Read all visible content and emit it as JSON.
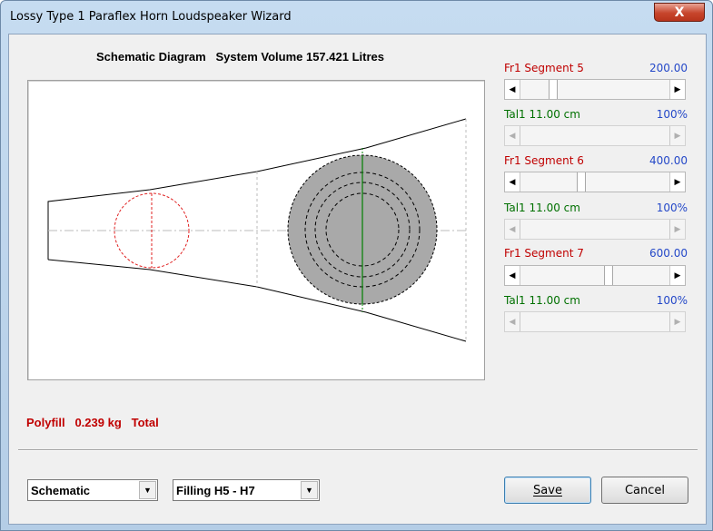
{
  "window": {
    "title": "Lossy Type 1 Paraflex Horn Loudspeaker Wizard",
    "close_glyph": "X"
  },
  "header": {
    "label": "Schematic Diagram",
    "volume": "System Volume 157.421 Litres"
  },
  "segments": [
    {
      "fr_label": "Fr1  Segment 5",
      "fr_value": "200.00",
      "fr_slider_fraction": 0.2,
      "tal_label": "Tal1  11.00 cm",
      "tal_value": "100%"
    },
    {
      "fr_label": "Fr1  Segment 6",
      "fr_value": "400.00",
      "fr_slider_fraction": 0.4,
      "tal_label": "Tal1  11.00 cm",
      "tal_value": "100%"
    },
    {
      "fr_label": "Fr1  Segment 7",
      "fr_value": "600.00",
      "fr_slider_fraction": 0.6,
      "tal_label": "Tal1  11.00 cm",
      "tal_value": "100%"
    }
  ],
  "polyfill": {
    "text": "Polyfill   0.239 kg   Total"
  },
  "view_combo": {
    "value": "Schematic"
  },
  "filling_combo": {
    "value": "Filling H5 - H7"
  },
  "buttons": {
    "save_label": "Save",
    "cancel_label": "Cancel"
  },
  "icons": {
    "left_arrow": "◀",
    "right_arrow": "▶",
    "down_arrow": "▼"
  },
  "colors": {
    "fr_label": "#c00000",
    "tal_label": "#007000",
    "value": "#2448c8",
    "polyfill": "#c00000",
    "driver_fill": "#a9a9a9"
  }
}
